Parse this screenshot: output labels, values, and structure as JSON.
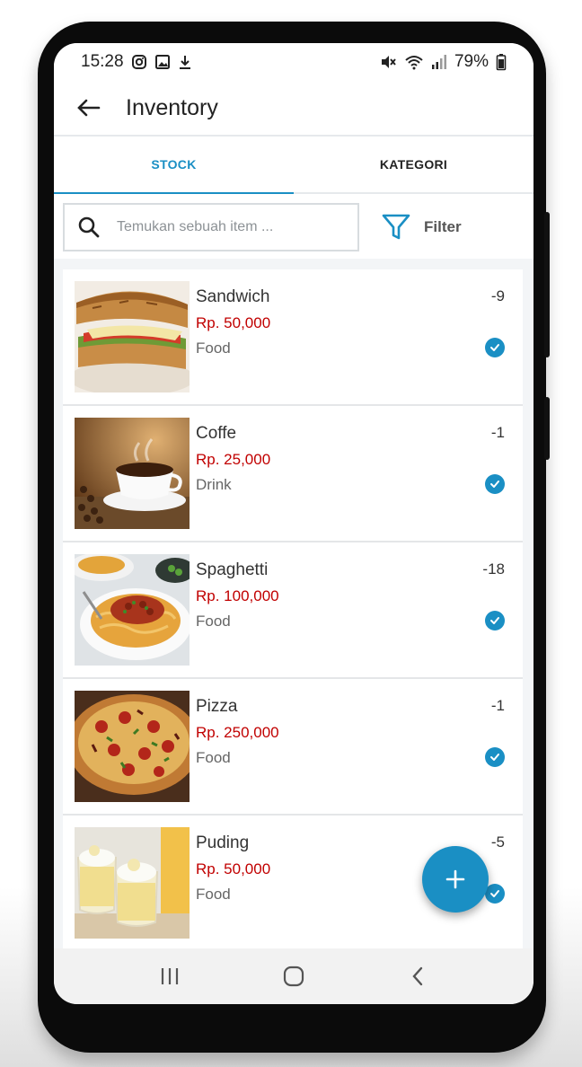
{
  "status_bar": {
    "time": "15:28",
    "battery": "79%",
    "icons_left": [
      "instagram-icon",
      "image-icon",
      "download-icon"
    ],
    "icons_right": [
      "mute-icon",
      "wifi-icon",
      "signal-icon",
      "battery-icon"
    ]
  },
  "app_bar": {
    "title": "Inventory",
    "back_icon": "arrow-left-icon"
  },
  "tabs": [
    {
      "label": "STOCK",
      "active": true
    },
    {
      "label": "KATEGORI",
      "active": false
    }
  ],
  "search": {
    "placeholder": "Temukan sebuah item ...",
    "value": ""
  },
  "filter": {
    "label": "Filter",
    "icon": "funnel-icon"
  },
  "items": [
    {
      "name": "Sandwich",
      "price": "Rp. 50,000",
      "category": "Food",
      "qty": "-9",
      "image": "sandwich",
      "checked": true
    },
    {
      "name": "Coffe",
      "price": "Rp. 25,000",
      "category": "Drink",
      "qty": "-1",
      "image": "coffee",
      "checked": true
    },
    {
      "name": "Spaghetti",
      "price": "Rp. 100,000",
      "category": "Food",
      "qty": "-18",
      "image": "spaghetti",
      "checked": true
    },
    {
      "name": "Pizza",
      "price": "Rp. 250,000",
      "category": "Food",
      "qty": "-1",
      "image": "pizza",
      "checked": true
    },
    {
      "name": "Puding",
      "price": "Rp. 50,000",
      "category": "Food",
      "qty": "-5",
      "image": "pudding",
      "checked": true
    }
  ],
  "fab": {
    "icon": "plus-icon"
  },
  "nav_bar": [
    "recent-apps-icon",
    "home-icon",
    "back-icon"
  ],
  "colors": {
    "accent": "#1a8fc4",
    "price": "#c10000",
    "phone_frame": "#0b0b0b"
  }
}
